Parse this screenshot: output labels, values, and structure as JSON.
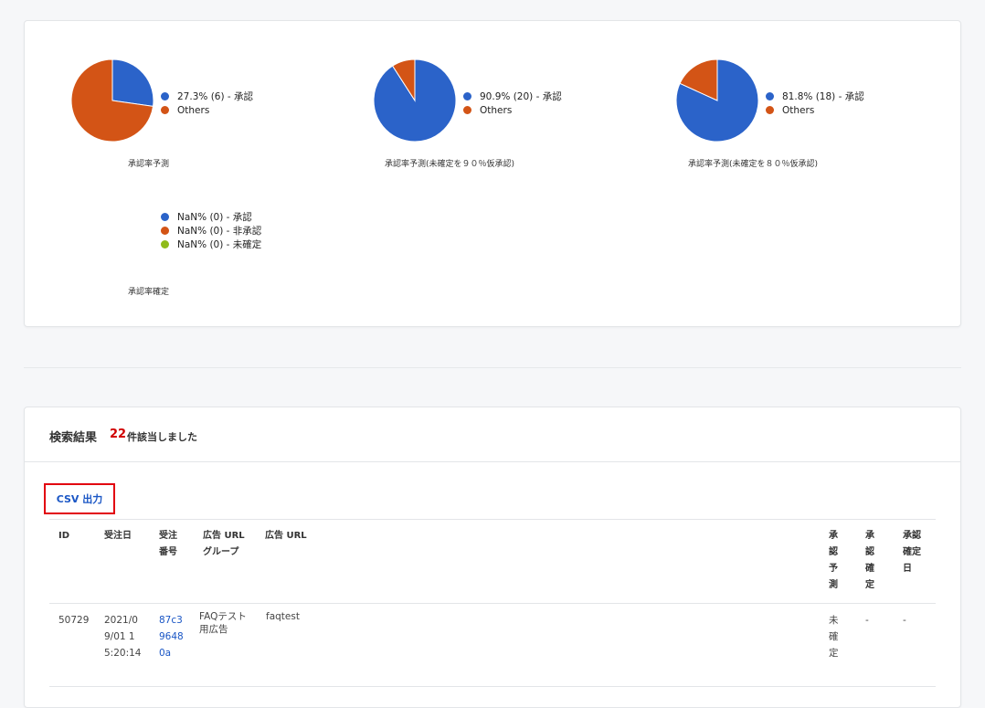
{
  "charts": [
    {
      "caption": "承認率予測",
      "legend": [
        {
          "label": "27.3% (6) - 承認",
          "color": "#2b63c9"
        },
        {
          "label": "Others",
          "color": "#d35416"
        }
      ]
    },
    {
      "caption": "承認率予測(未確定を９０％仮承認)",
      "legend": [
        {
          "label": "90.9% (20) - 承認",
          "color": "#2b63c9"
        },
        {
          "label": "Others",
          "color": "#d35416"
        }
      ]
    },
    {
      "caption": "承認率予測(未確定を８０％仮承認)",
      "legend": [
        {
          "label": "81.8% (18) - 承認",
          "color": "#2b63c9"
        },
        {
          "label": "Others",
          "color": "#d35416"
        }
      ]
    },
    {
      "caption": "承認率確定",
      "legend": [
        {
          "label": "NaN% (0) - 承認",
          "color": "#2b63c9"
        },
        {
          "label": "NaN% (0) - 非承認",
          "color": "#d35416"
        },
        {
          "label": "NaN% (0) - 未確定",
          "color": "#8fbb1a"
        }
      ]
    }
  ],
  "chart_data": [
    {
      "type": "pie",
      "title": "承認率予測",
      "labels": [
        "承認",
        "Others"
      ],
      "values": [
        6,
        16
      ],
      "percent": [
        27.3,
        72.7
      ],
      "colors": [
        "#2b63c9",
        "#d35416"
      ]
    },
    {
      "type": "pie",
      "title": "承認率予測(未確定を９０％仮承認)",
      "labels": [
        "承認",
        "Others"
      ],
      "values": [
        20,
        2
      ],
      "percent": [
        90.9,
        9.1
      ],
      "colors": [
        "#2b63c9",
        "#d35416"
      ]
    },
    {
      "type": "pie",
      "title": "承認率予測(未確定を８０％仮承認)",
      "labels": [
        "承認",
        "Others"
      ],
      "values": [
        18,
        4
      ],
      "percent": [
        81.8,
        18.2
      ],
      "colors": [
        "#2b63c9",
        "#d35416"
      ]
    },
    {
      "type": "pie",
      "title": "承認率確定",
      "labels": [
        "承認",
        "非承認",
        "未確定"
      ],
      "values": [
        0,
        0,
        0
      ],
      "colors": [
        "#2b63c9",
        "#d35416",
        "#8fbb1a"
      ]
    }
  ],
  "results": {
    "title": "検索結果",
    "count": "22",
    "suffix": "件該当しました",
    "csv_button": "CSV 出力"
  },
  "table": {
    "headers": [
      "ID",
      "受注日",
      "受注番号",
      "広告 URL グループ",
      "広告 URL",
      "承認予測",
      "承認確定",
      "承認確定日"
    ],
    "rows": [
      [
        "50729",
        "2021/09/01 15:20:14",
        "87c396480a",
        "FAQテスト用広告",
        "faqtest",
        "未確定",
        "-",
        "-"
      ]
    ]
  }
}
